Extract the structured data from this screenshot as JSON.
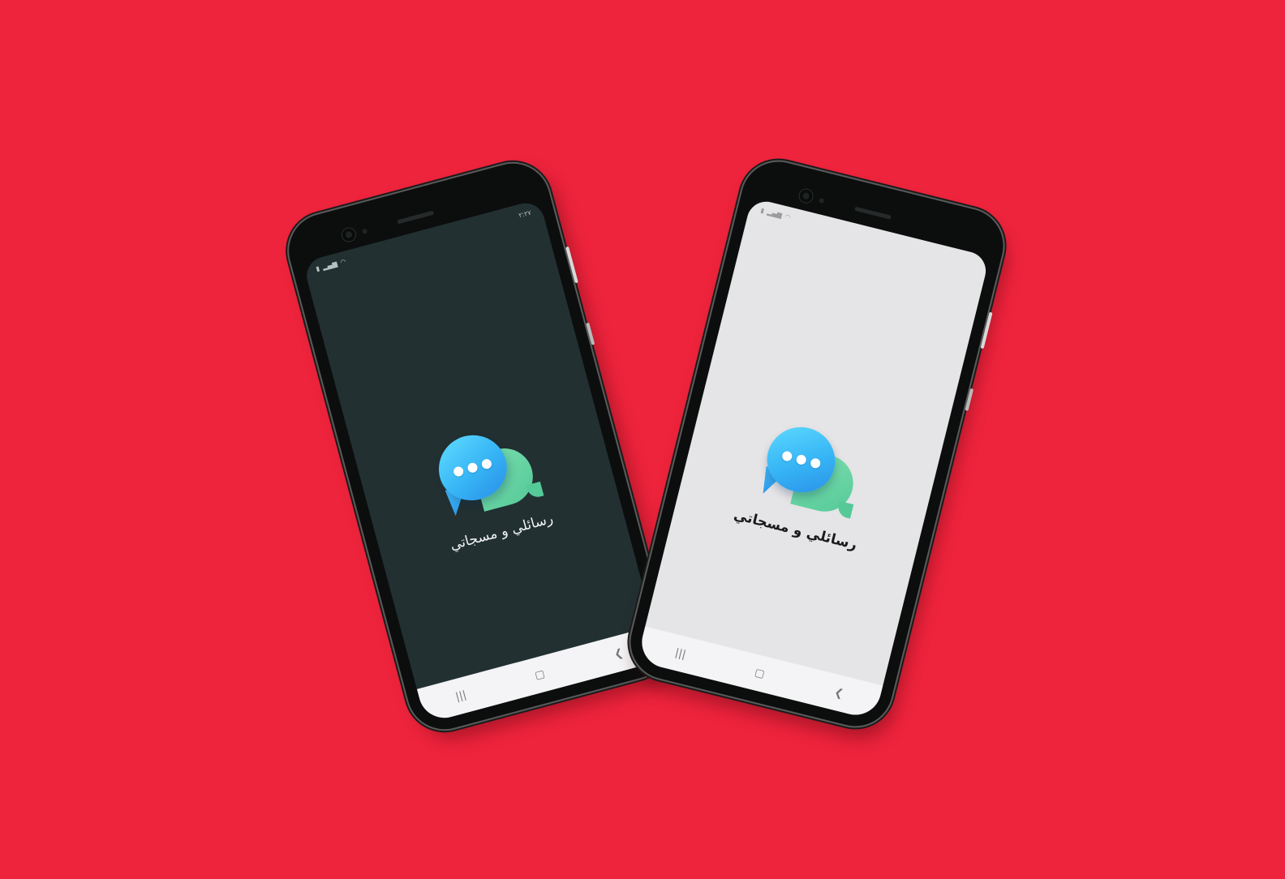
{
  "app": {
    "name": "رسائلي و مسجاتي"
  },
  "left_phone": {
    "theme": "dark",
    "screen_color": "#223032",
    "status_bar": {
      "time": "٢:٢٧",
      "icons": [
        "battery-icon",
        "signal-icon",
        "wifi-icon"
      ]
    },
    "nav": {
      "recents": "|||",
      "home": "▢",
      "back": "❮"
    }
  },
  "right_phone": {
    "theme": "light",
    "screen_color": "#e5e4e6",
    "status_bar": {
      "icons": [
        "battery-icon",
        "signal-icon",
        "wifi-icon"
      ]
    },
    "nav": {
      "recents": "|||",
      "home": "▢",
      "back": "❮"
    }
  },
  "colors": {
    "background": "#ee233c",
    "bubble_blue": "#36b4f5",
    "bubble_green": "#55c998"
  }
}
